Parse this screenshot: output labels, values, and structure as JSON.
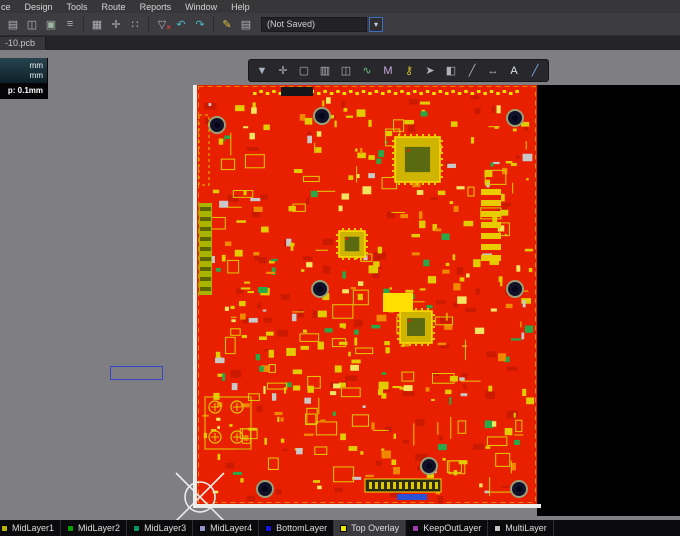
{
  "menu": {
    "items": [
      {
        "label": "ce"
      },
      {
        "label": "Design"
      },
      {
        "label": "Tools"
      },
      {
        "label": "Route"
      },
      {
        "label": "Reports"
      },
      {
        "label": "Window"
      },
      {
        "label": "Help"
      }
    ]
  },
  "toolbar": {
    "combo_value": "(Not Saved)",
    "dropdown_glyph": "▾",
    "icons": [
      {
        "name": "layers-icon",
        "glyph": "▤",
        "color": "#b0b0b8"
      },
      {
        "name": "paste-icon",
        "glyph": "◫",
        "color": "#b0b0b8"
      },
      {
        "name": "copy-icon",
        "glyph": "▣",
        "color": "#9fb89f"
      },
      {
        "name": "snippet-icon",
        "glyph": "≡",
        "color": "#b0b0b8"
      },
      {
        "sep": true
      },
      {
        "name": "grid-icon",
        "glyph": "▦",
        "color": "#b0b0b8"
      },
      {
        "name": "align-icon",
        "glyph": "✛",
        "color": "#b0b0b8"
      },
      {
        "name": "dots-icon",
        "glyph": "∷",
        "color": "#b0b0b8"
      },
      {
        "sep": true
      },
      {
        "name": "clear-filter-icon",
        "glyph": "▽",
        "color": "#b0b0b8",
        "overlay": "×",
        "overlay_color": "#d84040"
      },
      {
        "name": "undo-icon",
        "glyph": "↶",
        "color": "#4cb8c4"
      },
      {
        "name": "redo-icon",
        "glyph": "↷",
        "color": "#4cb8c4"
      },
      {
        "sep": true
      },
      {
        "name": "interactive-routing-icon",
        "glyph": "✎",
        "color": "#d8c040"
      },
      {
        "name": "board-icon",
        "glyph": "▤",
        "color": "#b0b0b8"
      }
    ]
  },
  "tabbar": {
    "active_tab": "-10.pcb"
  },
  "hud": {
    "line1": "mm",
    "line2": "mm",
    "snap": "p: 0.1mm"
  },
  "float_toolbar": {
    "icons": [
      {
        "name": "filter-icon",
        "glyph": "▼",
        "color": "#a8b2c2"
      },
      {
        "name": "move-icon",
        "glyph": "✛",
        "color": "#b2b2ba"
      },
      {
        "name": "select-area-icon",
        "glyph": "▢",
        "color": "#b2b2ba"
      },
      {
        "name": "board-regions-icon",
        "glyph": "▥",
        "color": "#b2b2ba"
      },
      {
        "name": "clipboard-icon",
        "glyph": "◫",
        "color": "#b2b2ba"
      },
      {
        "name": "route-icon",
        "glyph": "∿",
        "color": "#69c07a"
      },
      {
        "name": "measure-icon",
        "glyph": "M",
        "color": "#c9a8dc"
      },
      {
        "name": "key-icon",
        "glyph": "⚷",
        "color": "#d6c42e"
      },
      {
        "name": "cursor-icon",
        "glyph": "➤",
        "color": "#b2b2ba"
      },
      {
        "name": "union-icon",
        "glyph": "◧",
        "color": "#b2b2ba"
      },
      {
        "name": "line-icon",
        "glyph": "╱",
        "color": "#b2b2ba"
      },
      {
        "name": "dimension-icon",
        "glyph": "↔",
        "color": "#b2b2ba"
      },
      {
        "name": "text-icon",
        "glyph": "A",
        "color": "#dde2f0"
      },
      {
        "name": "draw-line-icon",
        "glyph": "╱",
        "color": "#7fa7e0"
      }
    ]
  },
  "layers": [
    {
      "label": "MidLayer1",
      "color": "#b8b400",
      "active": false
    },
    {
      "label": "MidLayer2",
      "color": "#00a000",
      "active": false
    },
    {
      "label": "MidLayer3",
      "color": "#009a60",
      "active": false
    },
    {
      "label": "MidLayer4",
      "color": "#9494cc",
      "active": false
    },
    {
      "label": "BottomLayer",
      "color": "#1414e0",
      "active": false
    },
    {
      "label": "Top Overlay",
      "color": "#e8e800",
      "active": true
    },
    {
      "label": "KeepOutLayer",
      "color": "#a23ab0",
      "active": false
    },
    {
      "label": "MultiLayer",
      "color": "#c4c4c4",
      "active": false
    }
  ],
  "pcb": {
    "colors": {
      "board": "#e82000",
      "silk": "#e2cc00"
    }
  }
}
